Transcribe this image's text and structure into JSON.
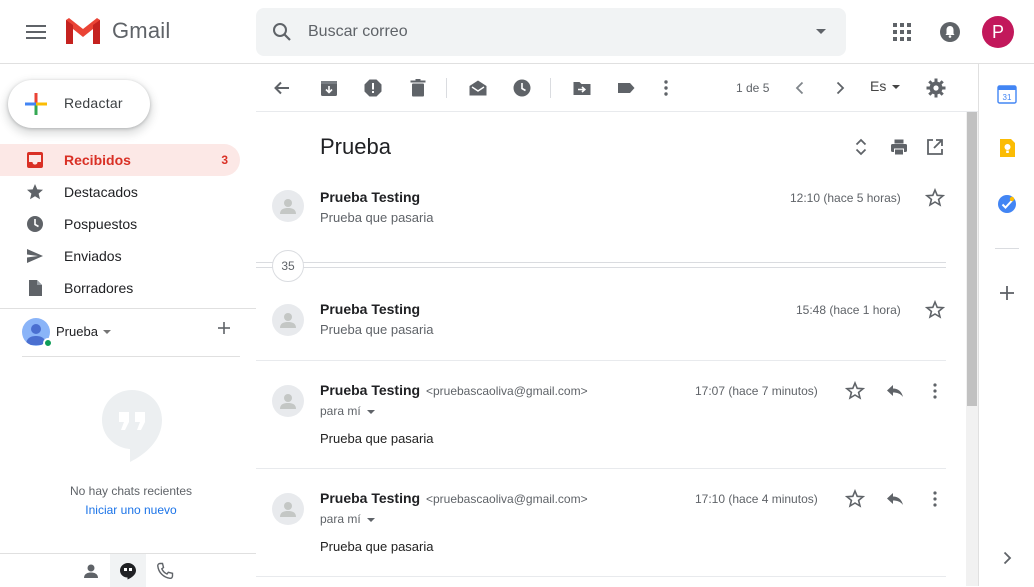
{
  "header": {
    "app_name": "Gmail",
    "search_placeholder": "Buscar correo",
    "avatar_letter": "P"
  },
  "sidebar": {
    "compose_label": "Redactar",
    "items": [
      {
        "label": "Recibidos",
        "count": "3",
        "active": true,
        "icon": "inbox-icon"
      },
      {
        "label": "Destacados",
        "count": "",
        "active": false,
        "icon": "star-icon"
      },
      {
        "label": "Pospuestos",
        "count": "",
        "active": false,
        "icon": "clock-icon"
      },
      {
        "label": "Enviados",
        "count": "",
        "active": false,
        "icon": "send-icon"
      },
      {
        "label": "Borradores",
        "count": "",
        "active": false,
        "icon": "draft-icon"
      }
    ],
    "hangouts_user": "Prueba",
    "no_chats": "No hay chats recientes",
    "start_new": "Iniciar uno nuevo"
  },
  "toolbar": {
    "pager": "1 de 5",
    "language": "Es"
  },
  "thread": {
    "subject": "Prueba",
    "collapsed_count": "35",
    "messages": [
      {
        "sender": "Prueba Testing",
        "email": "",
        "time": "12:10 (hace 5 horas)",
        "snippet": "Prueba que pasaria",
        "expanded": false
      },
      {
        "sender": "Prueba Testing",
        "email": "",
        "time": "15:48 (hace 1 hora)",
        "snippet": "Prueba que pasaria",
        "expanded": false
      },
      {
        "sender": "Prueba Testing",
        "email": "<pruebascaoliva@gmail.com>",
        "time": "17:07 (hace 7 minutos)",
        "to": "para mí",
        "body": "Prueba que pasaria",
        "expanded": true
      },
      {
        "sender": "Prueba Testing",
        "email": "<pruebascaoliva@gmail.com>",
        "time": "17:10 (hace 4 minutos)",
        "to": "para mí",
        "body": "Prueba que pasaria",
        "expanded": true
      }
    ]
  },
  "colors": {
    "active_red": "#d93025",
    "active_bg": "#fce8e6",
    "avatar": "#c2185b",
    "link_blue": "#1a73e8"
  }
}
